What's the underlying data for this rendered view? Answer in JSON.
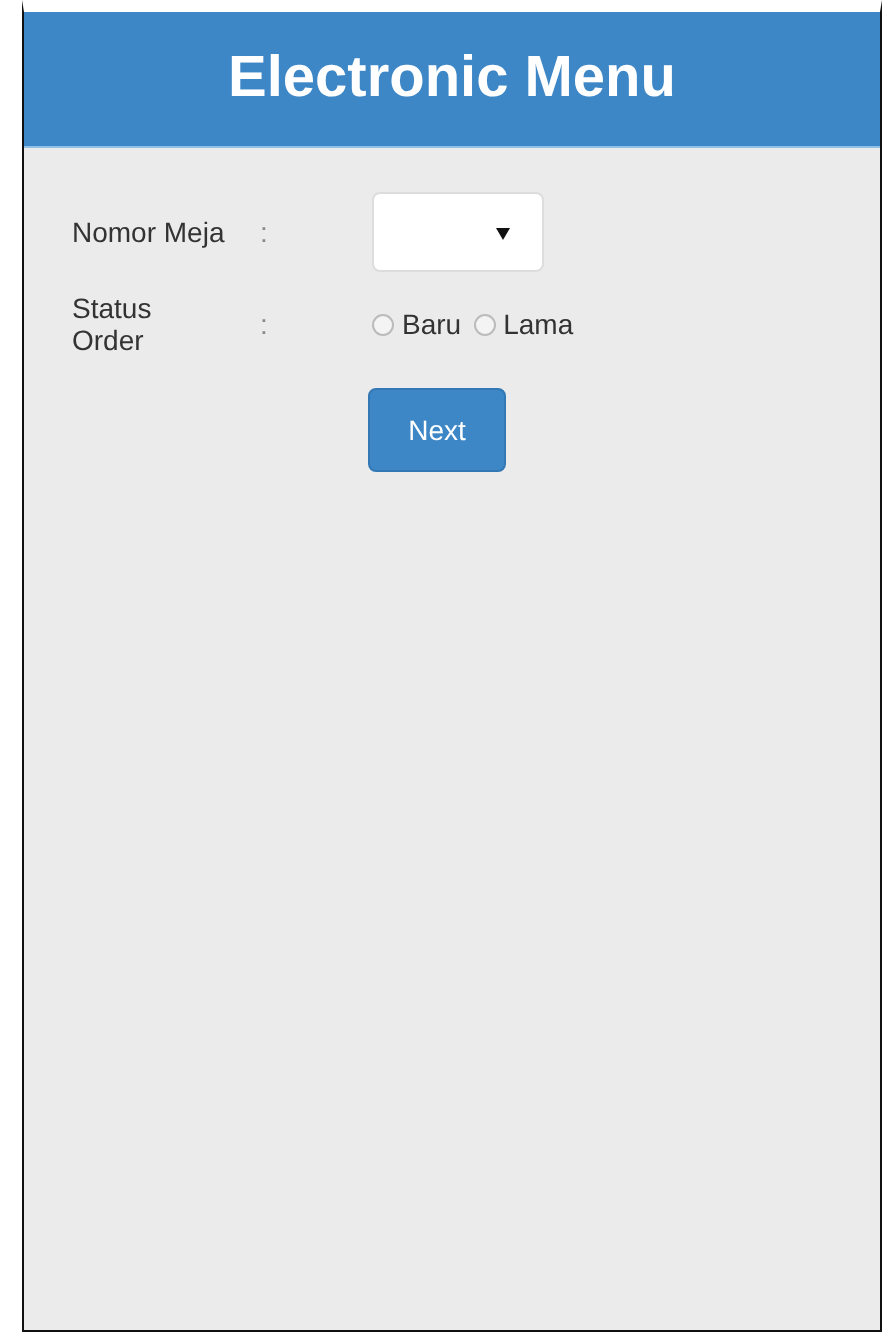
{
  "header": {
    "title": "Electronic Menu"
  },
  "form": {
    "table_number": {
      "label": "Nomor Meja",
      "separator": ":"
    },
    "order_status": {
      "label": "Status Order",
      "separator": ":",
      "options": [
        {
          "label": "Baru",
          "selected": false
        },
        {
          "label": "Lama",
          "selected": false
        }
      ]
    },
    "submit": "Next"
  }
}
